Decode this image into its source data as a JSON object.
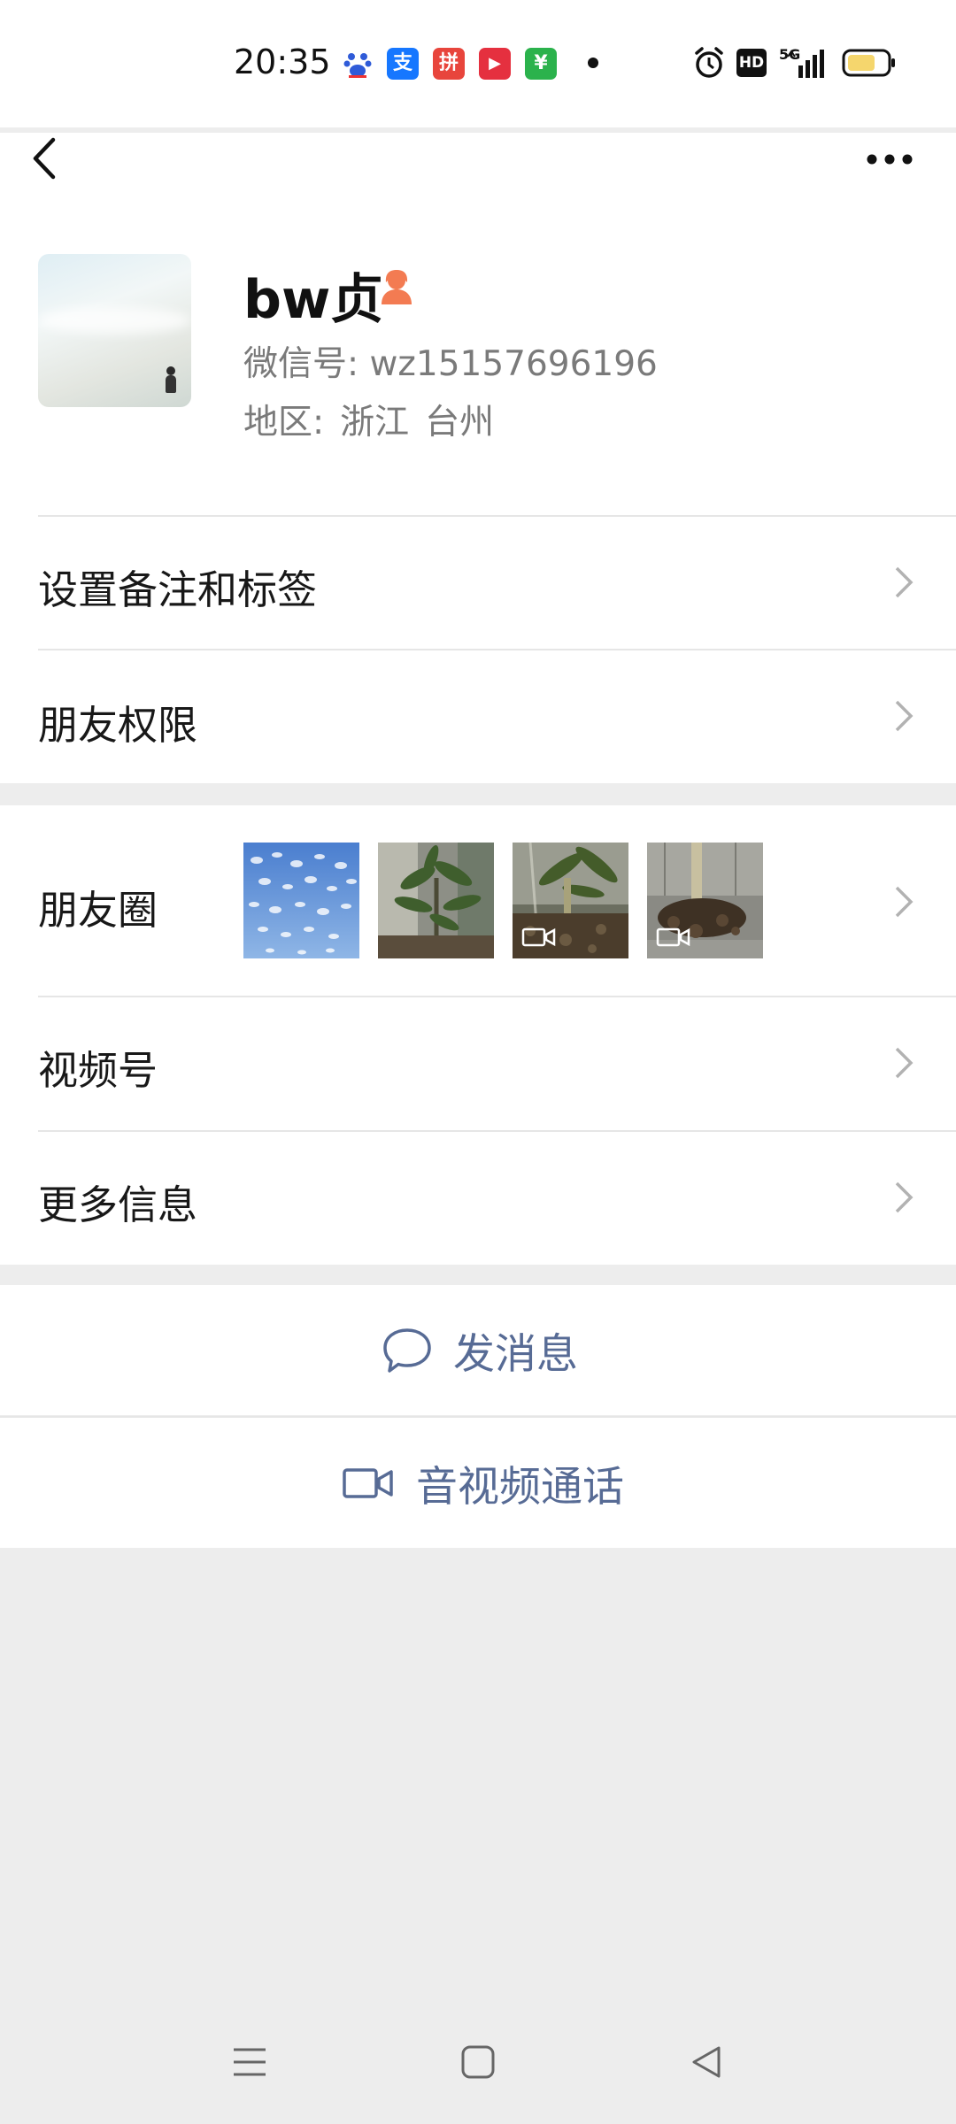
{
  "status_bar": {
    "time": "20:35",
    "apps": [
      {
        "name": "baidu-icon",
        "color": "#2f5bd8",
        "glyph": "🐾"
      },
      {
        "name": "alipay-icon",
        "color": "#1677ff",
        "glyph": "支"
      },
      {
        "name": "pdd-icon",
        "color": "#e8453c",
        "glyph": "拼"
      },
      {
        "name": "video-app-icon",
        "color": "#e5303f",
        "glyph": "▶"
      },
      {
        "name": "green-app-icon",
        "color": "#2bb24c",
        "glyph": "¥"
      }
    ],
    "hd_label": "HD",
    "network_label": "5G"
  },
  "profile": {
    "nickname": "bw贞",
    "wechat_id": "微信号: wz15157696196",
    "region_label": "地区:",
    "region_province": "浙江",
    "region_city": "台州",
    "gender_color": "#f37b52"
  },
  "menu": {
    "remark_tags": "设置备注和标签",
    "friend_permissions": "朋友权限",
    "moments": "朋友圈",
    "channels": "视频号",
    "more_info": "更多信息"
  },
  "actions": {
    "send_message": "发消息",
    "av_call": "音视频通话"
  },
  "colors": {
    "link_blue": "#576b95",
    "background": "#ededed",
    "card": "#ffffff"
  }
}
